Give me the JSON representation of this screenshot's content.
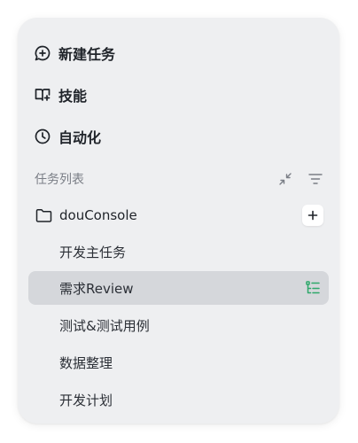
{
  "actions": [
    {
      "label": "新建任务",
      "icon": "chat-plus-icon"
    },
    {
      "label": "技能",
      "icon": "book-icon"
    },
    {
      "label": "自动化",
      "icon": "clock-icon"
    }
  ],
  "task_list": {
    "title": "任务列表",
    "collapse_icon": "collapse-icon",
    "filter_icon": "filter-icon",
    "folder": {
      "name": "douConsole",
      "add_label": "+"
    },
    "tasks": [
      {
        "label": "开发主任务",
        "selected": false
      },
      {
        "label": "需求Review",
        "selected": true
      },
      {
        "label": "测试&测试用例",
        "selected": false
      },
      {
        "label": "数据整理",
        "selected": false
      },
      {
        "label": "开发计划",
        "selected": false
      }
    ]
  },
  "colors": {
    "panel_bg": "#eeeff1",
    "selected_bg": "#d5d7db",
    "accent_green": "#2ea86b",
    "text_primary": "#1f2329",
    "text_muted": "#7a7e86"
  }
}
